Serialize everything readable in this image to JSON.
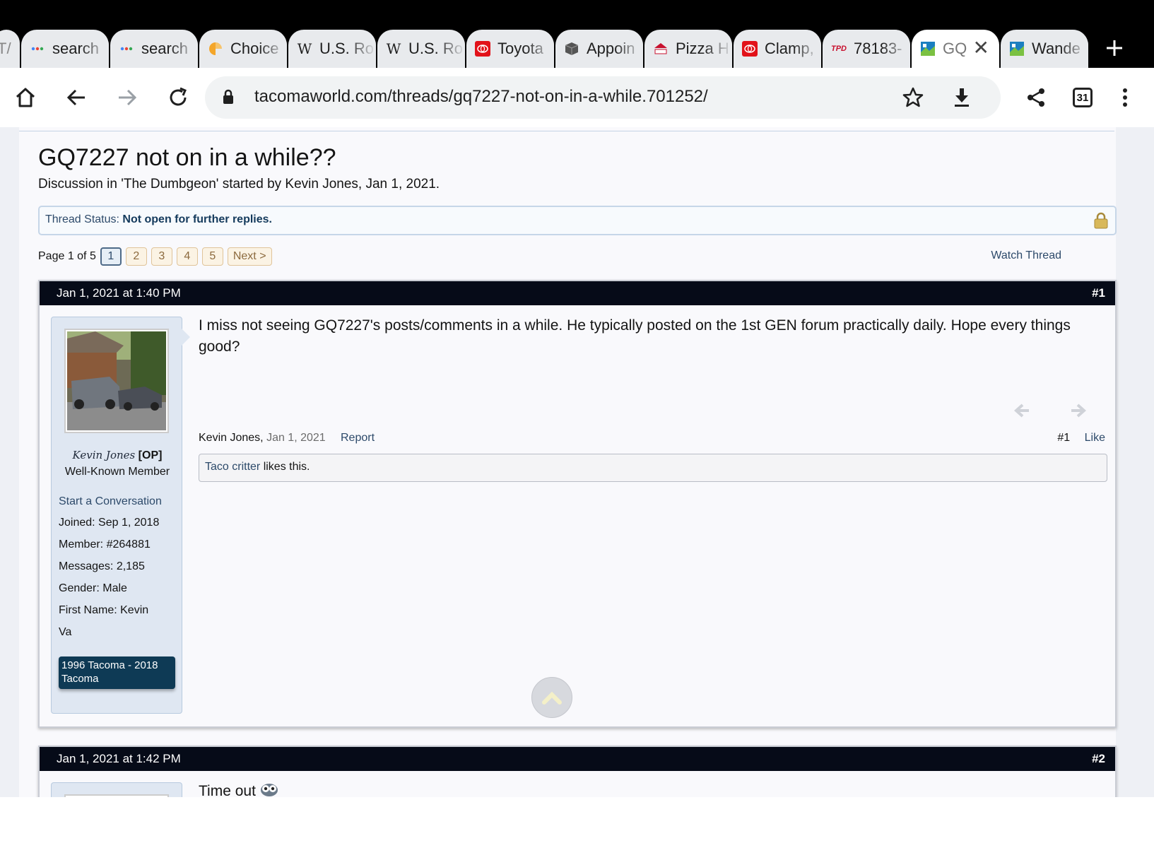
{
  "browser": {
    "tabs": [
      {
        "label": "T/",
        "icon": "partial-tab-icon",
        "color": "#e8eaed"
      },
      {
        "label": "search",
        "icon": "dots-icon",
        "color": "#4285f4"
      },
      {
        "label": "search",
        "icon": "dots-icon",
        "color": "#4285f4"
      },
      {
        "label": "Choice",
        "icon": "choice-icon",
        "color": "#f4a62a"
      },
      {
        "label": "U.S. Ro",
        "icon": "wikipedia-icon",
        "color": "#222222"
      },
      {
        "label": "U.S. Ro",
        "icon": "wikipedia-icon",
        "color": "#222222"
      },
      {
        "label": "Toyota",
        "icon": "toyota-icon",
        "color": "#e2121a"
      },
      {
        "label": "Appoin",
        "icon": "box-icon",
        "color": "#555555"
      },
      {
        "label": "Pizza H",
        "icon": "pizza-hut-icon",
        "color": "#c8102e"
      },
      {
        "label": "Clamp,",
        "icon": "toyota-icon",
        "color": "#e2121a"
      },
      {
        "label": "78183-",
        "icon": "tpd-icon",
        "color": "#c8102e"
      },
      {
        "label": "GQ",
        "icon": "tacomaworld-icon",
        "color": "#1b7fc0",
        "active": true
      },
      {
        "label": "Wande",
        "icon": "tacomaworld-icon",
        "color": "#1b7fc0"
      }
    ],
    "url": "tacomaworld.com/threads/gq7227-not-on-in-a-while.701252/",
    "tab_count": "31"
  },
  "thread": {
    "title": "GQ7227 not on in a while??",
    "description": "Discussion in 'The Dumbgeon' started by Kevin Jones, Jan 1, 2021.",
    "status_label": "Thread Status:",
    "status_value": "Not open for further replies.",
    "page_label": "Page 1 of 5",
    "pages": [
      "1",
      "2",
      "3",
      "4",
      "5"
    ],
    "next_label": "Next >",
    "watch_label": "Watch Thread"
  },
  "posts": [
    {
      "date": "Jan 1, 2021 at 1:40 PM",
      "number": "#1",
      "user": {
        "name": "Kevin Jones",
        "badge": "[OP]",
        "title": "Well-Known Member",
        "start_conversation": "Start a Conversation",
        "stats": [
          {
            "label": "Joined:",
            "value": "Sep 1, 2018"
          },
          {
            "label": "Member:",
            "value": "#264881"
          },
          {
            "label": "Messages:",
            "value": "2,185"
          },
          {
            "label": "Gender:",
            "value": "Male"
          },
          {
            "label": "First Name:",
            "value": "Kevin"
          },
          {
            "label": "",
            "value": "Va"
          }
        ],
        "vehicle": "1996 Tacoma - 2018 Tacoma"
      },
      "message": "I miss not seeing GQ7227's posts/comments in a while. He typically posted on the 1st GEN forum practically daily. Hope every things good?",
      "footer_author": "Kevin Jones,",
      "footer_date": "Jan 1, 2021",
      "report_label": "Report",
      "footer_number": "#1",
      "like_label": "Like",
      "likes_user": "Taco critter",
      "likes_text": " likes this."
    },
    {
      "date": "Jan 1, 2021 at 1:42 PM",
      "number": "#2",
      "message": "Time out"
    }
  ]
}
